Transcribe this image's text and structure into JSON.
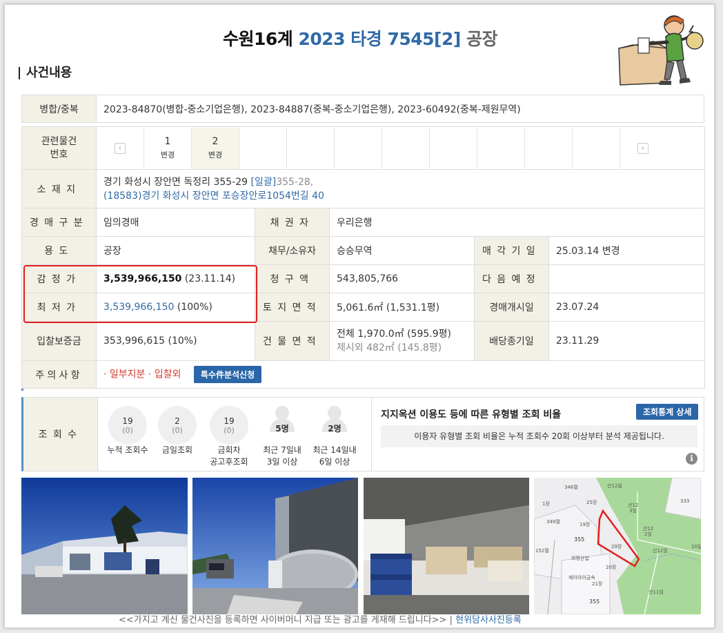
{
  "title": {
    "court": "수원16계",
    "case": "2023 타경 7545[2]",
    "type": "공장"
  },
  "section_title": "사건내용",
  "merge": {
    "label": "병합/중복",
    "value": "2023-84870(병합-중소기업은행), 2023-84887(중복-중소기업은행), 2023-60492(중복-제원무역)"
  },
  "related": {
    "label_line1": "관련물건",
    "label_line2": "번호",
    "prev": "‹",
    "next": "›",
    "items": [
      {
        "num": "1",
        "sub": "변경"
      },
      {
        "num": "2",
        "sub": "변경"
      }
    ]
  },
  "location": {
    "label": "소재지",
    "line1": "경기 화성시 장안면 독정리 355-29",
    "bulk_link": "[일괄]",
    "bulk_rest": "355-28,",
    "line2": "(18583)경기 화성시  장안면 포승장안로1054번길  40"
  },
  "rows": {
    "auction_type": {
      "label": "경매구분",
      "value": "임의경매"
    },
    "creditor": {
      "label": "채권자",
      "value": "우리은행"
    },
    "usage": {
      "label": "용도",
      "value": "공장"
    },
    "debtor": {
      "label": "채무/소유자",
      "value": "승승무역"
    },
    "sale_date": {
      "label": "매각기일",
      "value": "25.03.14  변경"
    },
    "appraisal": {
      "label": "감정가",
      "amount": "3,539,966,150",
      "date": "(23.11.14)"
    },
    "claim": {
      "label": "청구액",
      "value": "543,805,766"
    },
    "next_schedule": {
      "label": "다음예정",
      "value": ""
    },
    "minimum": {
      "label": "최저가",
      "amount": "3,539,966,150",
      "pct": "(100%)"
    },
    "land_area": {
      "label": "토지면적",
      "value": "5,061.6㎡ (1,531.1평)"
    },
    "start_date": {
      "label": "경매개시일",
      "value": "23.07.24"
    },
    "deposit": {
      "label": "입찰보증금",
      "value": "353,996,615 (10%)"
    },
    "building_area": {
      "label": "건물면적",
      "line1": "전체 1,970.0㎡ (595.9평)",
      "line2": "제시외 482㎡ (145.8평)"
    },
    "dividend_date": {
      "label": "배당종기일",
      "value": "23.11.29"
    },
    "notes": {
      "label": "주의사항",
      "value": "· 일부지분 · 입찰외",
      "button": "특수件분석신청"
    }
  },
  "views": {
    "label": "조회수",
    "stats": [
      {
        "value": "19",
        "sub": "(0)",
        "cap1": "누적 조회수",
        "cap2": ""
      },
      {
        "value": "2",
        "sub": "(0)",
        "cap1": "금일조회",
        "cap2": ""
      },
      {
        "value": "19",
        "sub": "(0)",
        "cap1": "금회차",
        "cap2": "공고후조회"
      }
    ],
    "people": [
      {
        "count": "5명",
        "cap1": "최근 7일내",
        "cap2": "3일 이상"
      },
      {
        "count": "2명",
        "cap1": "최근 14일내",
        "cap2": "6일 이상"
      }
    ],
    "ratio_title": "지지옥션 이용도 등에 따른 유형별 조회 비율",
    "detail_button": "조회통계 상세",
    "ratio_note": "이용자 유형별 조회 비율은 누적 조회수 20회 이상부터 분석 제공됩니다.",
    "info_icon": "i"
  },
  "map_labels": {
    "l1": "346렬",
    "l2": "산12일",
    "l3": "산12",
    "l4": "3임",
    "l5": "355",
    "l6": "29장",
    "l7": "희명산업",
    "l8": "제이아이금속",
    "l9": "산12",
    "l10": "2임",
    "l11": "20장",
    "l12": "산11임",
    "l13": "산12임",
    "l14": "10일",
    "l15": "333",
    "l16": "349렬",
    "l17": "152렬",
    "l18": "21장",
    "l19": "355",
    "l20": "19장",
    "l21": "1장",
    "l22": "25장"
  },
  "caption": {
    "text": "<<가지고 계신 물건사진을 등록하면 사이버머니 지급 또는 광고를 게재해 드립니다>>  |",
    "link": "현위담사사진등록"
  }
}
